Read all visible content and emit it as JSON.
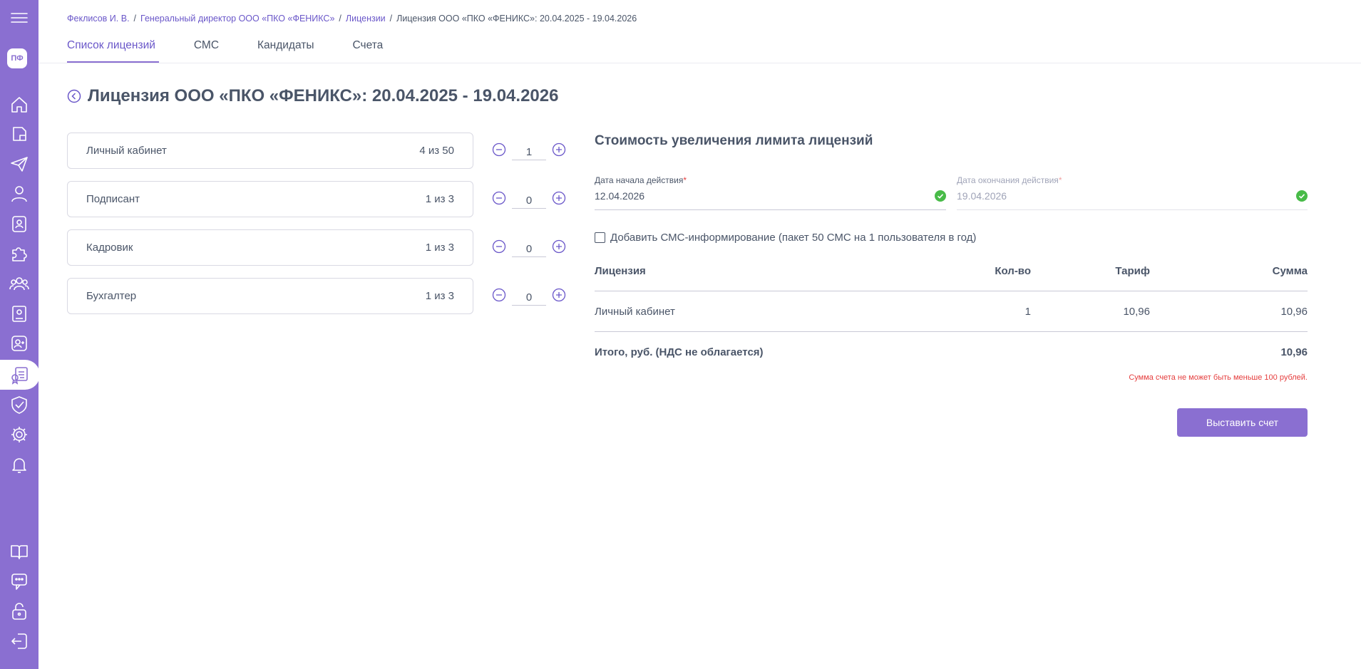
{
  "user": {
    "initials": "ПФ"
  },
  "breadcrumb": [
    "Феклисов И. В.",
    "Генеральный директор ООО «ПКО «ФЕНИКС»",
    "Лицензии",
    "Лицензия ООО «ПКО «ФЕНИКС»: 20.04.2025 - 19.04.2026"
  ],
  "tabs": [
    {
      "label": "Список лицензий",
      "active": true
    },
    {
      "label": "СМС",
      "active": false
    },
    {
      "label": "Кандидаты",
      "active": false
    },
    {
      "label": "Счета",
      "active": false
    }
  ],
  "page": {
    "title": "Лицензия ООО «ПКО «ФЕНИКС»: 20.04.2025 - 19.04.2026"
  },
  "licenses": [
    {
      "name": "Личный кабинет",
      "usage": "4 из 50",
      "add": "1"
    },
    {
      "name": "Подписант",
      "usage": "1 из 3",
      "add": "0"
    },
    {
      "name": "Кадровик",
      "usage": "1 из 3",
      "add": "0"
    },
    {
      "name": "Бухгалтер",
      "usage": "1 из 3",
      "add": "0"
    }
  ],
  "panel": {
    "title": "Стоимость увеличения лимита лицензий",
    "start_date": {
      "label": "Дата начала действия",
      "required_mark": "*",
      "value": "12.04.2026"
    },
    "end_date": {
      "label": "Дата окончания действия",
      "required_mark": "*",
      "value": "19.04.2026"
    },
    "sms_option": "Добавить СМС-информирование (пакет 50 СМС на 1 пользователя в год)",
    "table": {
      "headers": {
        "license": "Лицензия",
        "qty": "Кол-во",
        "tariff": "Тариф",
        "sum": "Сумма"
      },
      "rows": [
        {
          "license": "Личный кабинет",
          "qty": "1",
          "tariff": "10,96",
          "sum": "10,96"
        }
      ],
      "total_label": "Итого, руб. (НДС не облагается)",
      "total_value": "10,96"
    },
    "error": "Сумма счета не может быть меньше 100 рублей.",
    "submit_label": "Выставить счет"
  },
  "colors": {
    "accent": "#8a6fd1",
    "link": "#6a57c9",
    "text": "#4a5568",
    "error": "#e53e3e",
    "success": "#48bb48"
  }
}
